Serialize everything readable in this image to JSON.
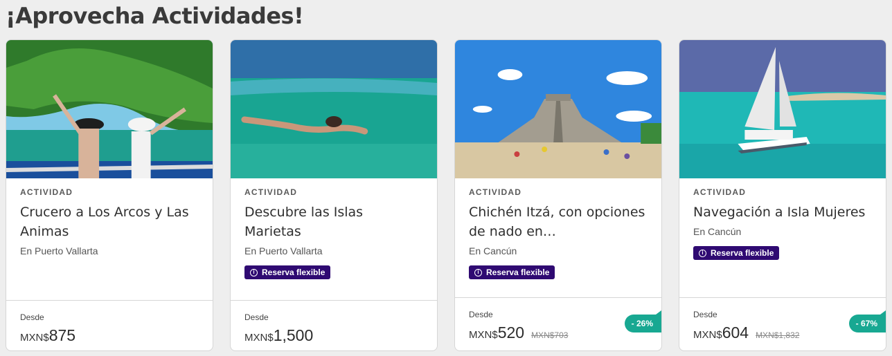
{
  "section": {
    "title": "¡Aprovecha Actividades!"
  },
  "cards": [
    {
      "category": "ACTIVIDAD",
      "title": "Crucero a Los Arcos y Las Animas",
      "location": "En Puerto Vallarta",
      "badge": "",
      "from": "Desde",
      "currency": "MXN$",
      "price": "875",
      "old_price": "",
      "discount": ""
    },
    {
      "category": "ACTIVIDAD",
      "title": "Descubre las Islas Marietas",
      "location": "En Puerto Vallarta",
      "badge": "Reserva flexible",
      "from": "Desde",
      "currency": "MXN$",
      "price": "1,500",
      "old_price": "",
      "discount": ""
    },
    {
      "category": "ACTIVIDAD",
      "title": "Chichén Itzá, con opciones de nado en…",
      "location": "En Cancún",
      "badge": "Reserva flexible",
      "from": "Desde",
      "currency": "MXN$",
      "price": "520",
      "old_price": "MXN$703",
      "discount": "- 26%"
    },
    {
      "category": "ACTIVIDAD",
      "title": "Navegación a Isla Mujeres",
      "location": "En Cancún",
      "badge": "Reserva flexible",
      "from": "Desde",
      "currency": "MXN$",
      "price": "604",
      "old_price": "MXN$1,832",
      "discount": "- 67%"
    }
  ],
  "colors": {
    "badge_bg": "#2f0a72",
    "discount_bg": "#18a892",
    "page_bg": "#eeeeee"
  },
  "icons": {
    "badge_icon": "info-circle-icon"
  }
}
